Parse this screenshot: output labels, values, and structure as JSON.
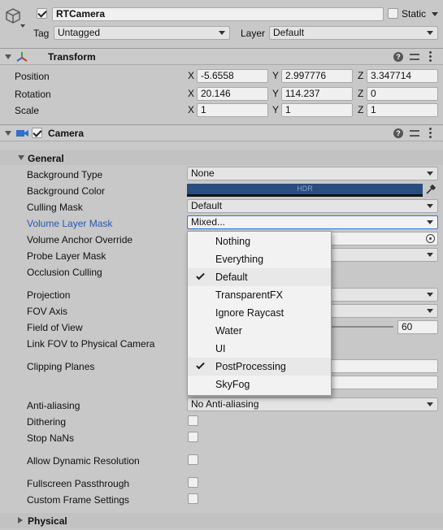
{
  "object": {
    "name": "RTCamera",
    "static_label": "Static",
    "tag_label": "Tag",
    "tag_value": "Untagged",
    "layer_label": "Layer",
    "layer_value": "Default"
  },
  "transform": {
    "title": "Transform",
    "rows": [
      {
        "label": "Position",
        "x": "-5.6558",
        "y": "2.997776",
        "z": "3.347714"
      },
      {
        "label": "Rotation",
        "x": "20.146",
        "y": "114.237",
        "z": "0"
      },
      {
        "label": "Scale",
        "x": "1",
        "y": "1",
        "z": "1"
      }
    ],
    "axes": {
      "x": "X",
      "y": "Y",
      "z": "Z"
    }
  },
  "camera": {
    "title": "Camera",
    "general": "General",
    "background_type": {
      "label": "Background Type",
      "value": "None"
    },
    "background_color": {
      "label": "Background Color",
      "hdr": "HDR"
    },
    "culling_mask": {
      "label": "Culling Mask",
      "value": "Default"
    },
    "volume_layer_mask": {
      "label": "Volume Layer Mask",
      "value": "Mixed..."
    },
    "volume_anchor_override": {
      "label": "Volume Anchor Override"
    },
    "probe_layer_mask": {
      "label": "Probe Layer Mask"
    },
    "occlusion_culling": {
      "label": "Occlusion Culling"
    },
    "projection": {
      "label": "Projection"
    },
    "fov_axis": {
      "label": "FOV Axis"
    },
    "field_of_view": {
      "label": "Field of View",
      "value": "60"
    },
    "link_fov": {
      "label": "Link FOV to Physical Camera"
    },
    "clipping_planes": {
      "label": "Clipping Planes"
    },
    "anti_aliasing": {
      "label": "Anti-aliasing",
      "value": "No Anti-aliasing"
    },
    "dithering": {
      "label": "Dithering"
    },
    "stop_nans": {
      "label": "Stop NaNs"
    },
    "allow_dynamic_resolution": {
      "label": "Allow Dynamic Resolution"
    },
    "fullscreen_passthrough": {
      "label": "Fullscreen Passthrough"
    },
    "custom_frame_settings": {
      "label": "Custom Frame Settings"
    },
    "physical": "Physical"
  },
  "popup": {
    "items": [
      {
        "label": "Nothing",
        "checked": false
      },
      {
        "label": "Everything",
        "checked": false
      },
      {
        "label": "Default",
        "checked": true
      },
      {
        "label": "TransparentFX",
        "checked": false
      },
      {
        "label": "Ignore Raycast",
        "checked": false
      },
      {
        "label": "Water",
        "checked": false
      },
      {
        "label": "UI",
        "checked": false
      },
      {
        "label": "PostProcessing",
        "checked": true
      },
      {
        "label": "SkyFog",
        "checked": false
      }
    ]
  },
  "colors": {
    "background_color_swatch": "#2a4d7f",
    "active_label": "#2458b8",
    "check_row_highlight": "#e8e8e8"
  }
}
